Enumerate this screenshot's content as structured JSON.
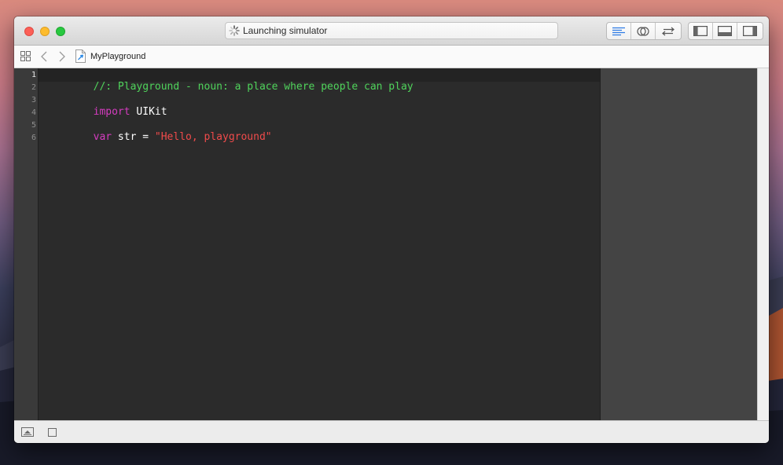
{
  "window": {
    "activity_status": "Launching simulator"
  },
  "jumpbar": {
    "file_name": "MyPlayground"
  },
  "editor": {
    "line_numbers": [
      "1",
      "2",
      "3",
      "4",
      "5",
      "6"
    ],
    "lines": [
      {
        "comment": "//: Playground - noun: a place where people can play"
      },
      {},
      {
        "keyword": "import",
        "plain": " UIKit"
      },
      {},
      {
        "keyword": "var",
        "plain": " str = ",
        "string": "\"Hello, playground\""
      },
      {}
    ]
  },
  "colors": {
    "editor_background": "#2b2b2b",
    "comment": "#4fd35b",
    "keyword": "#d63cc0",
    "string": "#f04b4b"
  },
  "icons": {
    "toolbar": [
      "standard-editor-icon",
      "assistant-editor-icon",
      "version-editor-icon",
      "navigator-toggle-icon",
      "debug-area-toggle-icon",
      "utilities-toggle-icon"
    ],
    "jumpbar": [
      "related-items-grid-icon",
      "back-chevron-icon",
      "forward-chevron-icon",
      "playground-file-icon"
    ],
    "bottombar": [
      "show-debug-area-icon",
      "stop-icon"
    ]
  }
}
